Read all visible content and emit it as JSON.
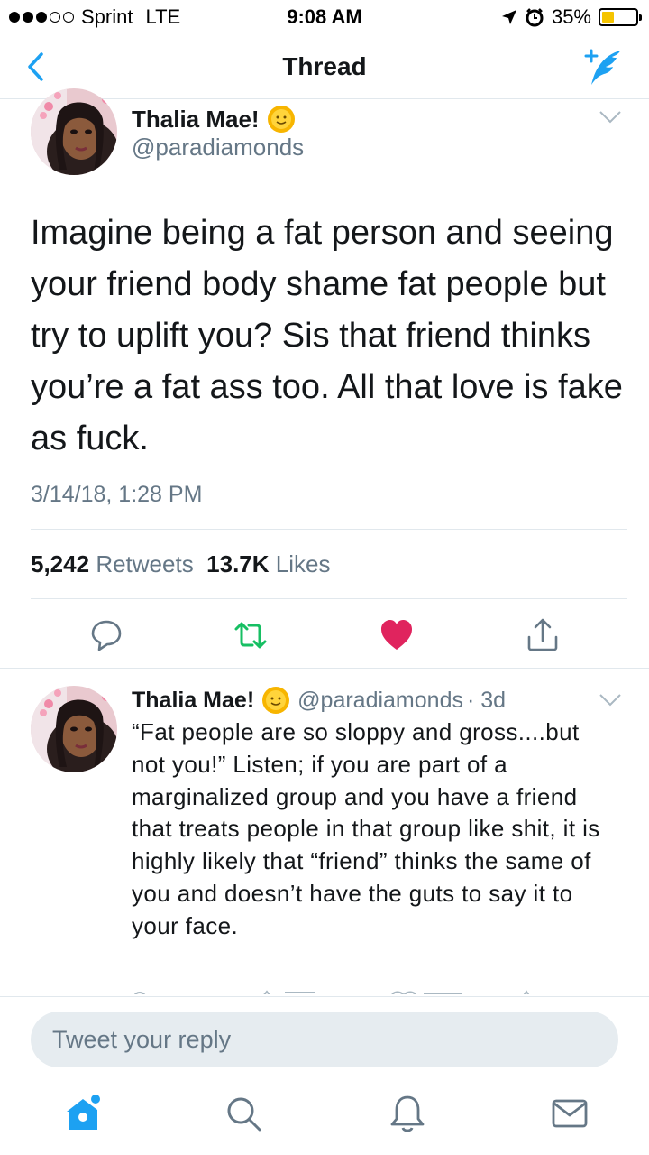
{
  "status_bar": {
    "carrier": "Sprint",
    "network": "LTE",
    "time": "9:08 AM",
    "battery": "35%",
    "battery_level": 0.35,
    "signal_bars": 3,
    "signal_total": 5
  },
  "nav": {
    "title": "Thread"
  },
  "main_tweet": {
    "name": "Thalia Mae!",
    "handle": "@paradiamonds",
    "text": "Imagine being a fat person and seeing your friend body shame fat people but try to uplift you? Sis that friend thinks you’re a fat ass too. All that love is fake as fuck.",
    "date": "3/14/18, 1:28 PM",
    "retweets_count": "5,242",
    "retweets_label": "Retweets",
    "likes_count": "13.7K",
    "likes_label": "Likes",
    "liked": true
  },
  "reply_tweet": {
    "name": "Thalia Mae!",
    "handle": "@paradiamonds",
    "age": "· 3d",
    "text": "“Fat people are so sloppy and gross....but not you!” Listen; if you are part of a marginalized group and you have a friend that treats people in that group like shit, it is highly likely that “friend” thinks the same of you and doesn’t have the guts to say it to your face."
  },
  "composer": {
    "placeholder": "Tweet your reply"
  },
  "colors": {
    "brand": "#1da1f2",
    "retweet": "#17bf63",
    "like": "#e0245e",
    "secondary_text": "#657786",
    "border": "#e1e8ed"
  },
  "icons": {
    "back": "chevron-left-icon",
    "compose": "compose-tweet-icon",
    "reply": "reply-icon",
    "retweet": "retweet-icon",
    "like": "heart-icon",
    "share": "share-icon",
    "home": "home-icon",
    "search": "search-icon",
    "notifications": "bell-icon",
    "messages": "envelope-icon"
  }
}
